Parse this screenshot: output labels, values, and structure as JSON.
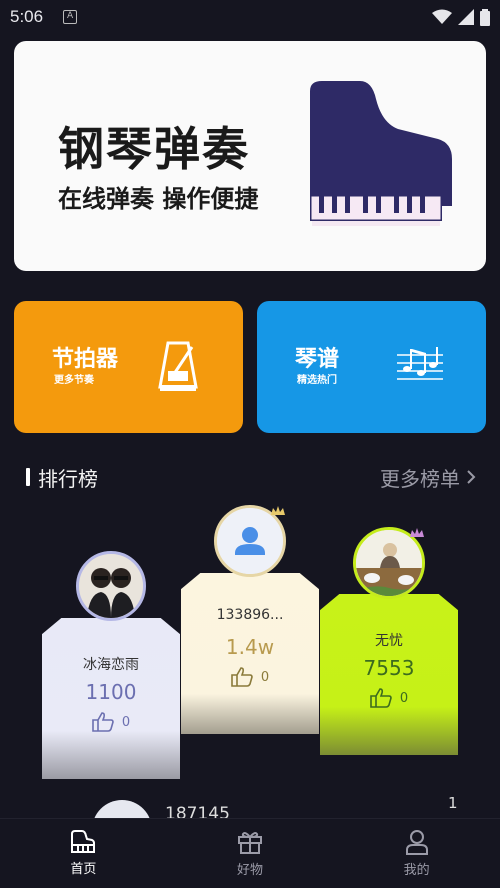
{
  "status_bar": {
    "time": "5:06",
    "notification_icon": "A"
  },
  "banner": {
    "title": "钢琴弹奏",
    "subtitle": "在线弹奏 操作便捷",
    "icon": "grand-piano-icon"
  },
  "cards": [
    {
      "title": "节拍器",
      "subtitle": "更多节奏",
      "icon": "metronome-icon",
      "color": "#f49a0d"
    },
    {
      "title": "琴谱",
      "subtitle": "精选热门",
      "icon": "music-notes-icon",
      "color": "#1697e6"
    }
  ],
  "ranking": {
    "title": "排行榜",
    "more": "更多榜单",
    "podium": [
      {
        "name": "冰海恋雨",
        "score": "1100",
        "likes": "0",
        "score_color": "#6b6fb0"
      },
      {
        "name": "133896...",
        "score": "1.4w",
        "likes": "0",
        "score_color": "#b89a4e"
      },
      {
        "name": "无忧",
        "score": "7553",
        "likes": "0",
        "score_color": "#3c6b1e"
      }
    ],
    "next": {
      "name": "187145",
      "rank": "1"
    }
  },
  "tabs": [
    {
      "label": "首页",
      "icon": "piano-icon",
      "active": true
    },
    {
      "label": "好物",
      "icon": "gift-icon",
      "active": false
    },
    {
      "label": "我的",
      "icon": "user-icon",
      "active": false
    }
  ]
}
